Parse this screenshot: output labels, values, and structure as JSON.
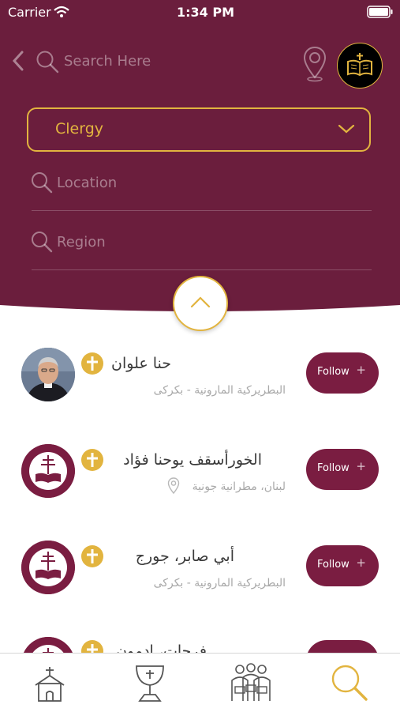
{
  "status_bar": {
    "carrier": "Carrier",
    "time": "1:34 PM"
  },
  "search": {
    "placeholder": "Search Here"
  },
  "filters": {
    "category": {
      "selected": "Clergy"
    },
    "location": {
      "placeholder": "Location"
    },
    "region": {
      "placeholder": "Region"
    }
  },
  "results": [
    {
      "name": "حنا علوان",
      "subtitle": "البطريركية المارونية - بكركى",
      "avatar": "photo",
      "location_icon": false,
      "follow_label": "Follow",
      "follow_plus": "+"
    },
    {
      "name": "الخورأسقف يوحنا فؤاد",
      "subtitle": "لبنان، مطرانية جونية",
      "avatar": "church-logo",
      "location_icon": true,
      "follow_label": "Follow",
      "follow_plus": "+"
    },
    {
      "name": "أبي صابر، جورج",
      "subtitle": "البطريركية المارونية - بكركى",
      "avatar": "church-logo",
      "location_icon": false,
      "follow_label": "Follow",
      "follow_plus": "+"
    },
    {
      "name": "فرحات، ادمون",
      "subtitle": "",
      "avatar": "church-logo",
      "location_icon": false,
      "follow_label": "",
      "follow_plus": ""
    }
  ],
  "tab_bar": {
    "items": [
      {
        "icon": "church-icon",
        "active": false
      },
      {
        "icon": "chalice-icon",
        "active": false
      },
      {
        "icon": "people-icon",
        "active": false
      },
      {
        "icon": "search-icon",
        "active": true
      }
    ]
  },
  "colors": {
    "primary": "#6b1e3d",
    "accent": "#e2b43f",
    "button": "#7a1d41",
    "muted_text": "#a8a8a8"
  }
}
